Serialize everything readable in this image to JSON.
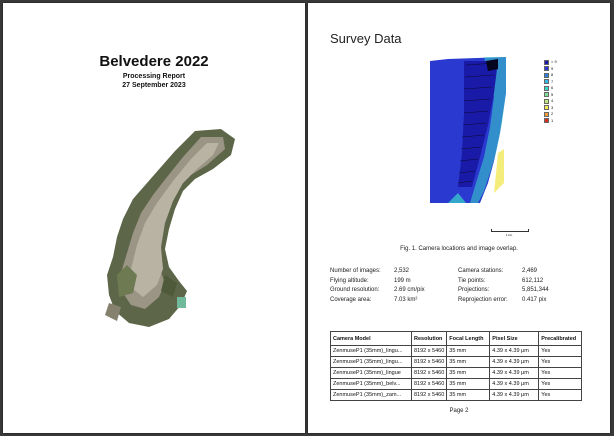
{
  "page1": {
    "title": "Belvedere 2022",
    "subtitle": "Processing Report",
    "date": "27 September 2023"
  },
  "page2": {
    "section_title": "Survey Data",
    "legend": [
      {
        "label": "> 9",
        "color": "#1a1aa8"
      },
      {
        "label": "9",
        "color": "#2a3ad0"
      },
      {
        "label": "8",
        "color": "#2f7fe0"
      },
      {
        "label": "7",
        "color": "#34b8e8"
      },
      {
        "label": "6",
        "color": "#3ad6c8"
      },
      {
        "label": "5",
        "color": "#7ee09a"
      },
      {
        "label": "4",
        "color": "#bfe878"
      },
      {
        "label": "3",
        "color": "#f2e85a"
      },
      {
        "label": "2",
        "color": "#f2a03a"
      },
      {
        "label": "1",
        "color": "#d83020"
      }
    ],
    "scale_label": "1 km",
    "figure_caption": "Fig. 1. Camera locations and image overlap.",
    "stats": [
      {
        "label": "Number of images:",
        "value": "2,532",
        "label2": "Camera stations:",
        "value2": "2,469"
      },
      {
        "label": "Flying altitude:",
        "value": "199 m",
        "label2": "Tie points:",
        "value2": "612,112"
      },
      {
        "label": "Ground resolution:",
        "value": "2.69 cm/pix",
        "label2": "Projections:",
        "value2": "5,851,344"
      },
      {
        "label": "Coverage area:",
        "value": "7.03 km²",
        "label2": "Reprojection error:",
        "value2": "0.417 pix"
      }
    ],
    "camera_table": {
      "headers": [
        "Camera Model",
        "Resolution",
        "Focal Length",
        "Pixel Size",
        "Precalibrated"
      ],
      "rows": [
        [
          "ZenmuseP1 (35mm)_lingu...",
          "8192 x 5460",
          "35 mm",
          "4.39 x 4.39 μm",
          "Yes"
        ],
        [
          "ZenmuseP1 (35mm)_lingu...",
          "8192 x 5460",
          "35 mm",
          "4.39 x 4.39 μm",
          "Yes"
        ],
        [
          "ZenmuseP1 (35mm)_lingue",
          "8192 x 5460",
          "35 mm",
          "4.39 x 4.39 μm",
          "Yes"
        ],
        [
          "ZenmuseP1 (35mm)_belv...",
          "8192 x 5460",
          "35 mm",
          "4.39 x 4.39 μm",
          "Yes"
        ],
        [
          "ZenmuseP1 (35mm)_zam...",
          "8192 x 5460",
          "35 mm",
          "4.39 x 4.39 μm",
          "Yes"
        ]
      ]
    },
    "page_number": "Page 2"
  }
}
